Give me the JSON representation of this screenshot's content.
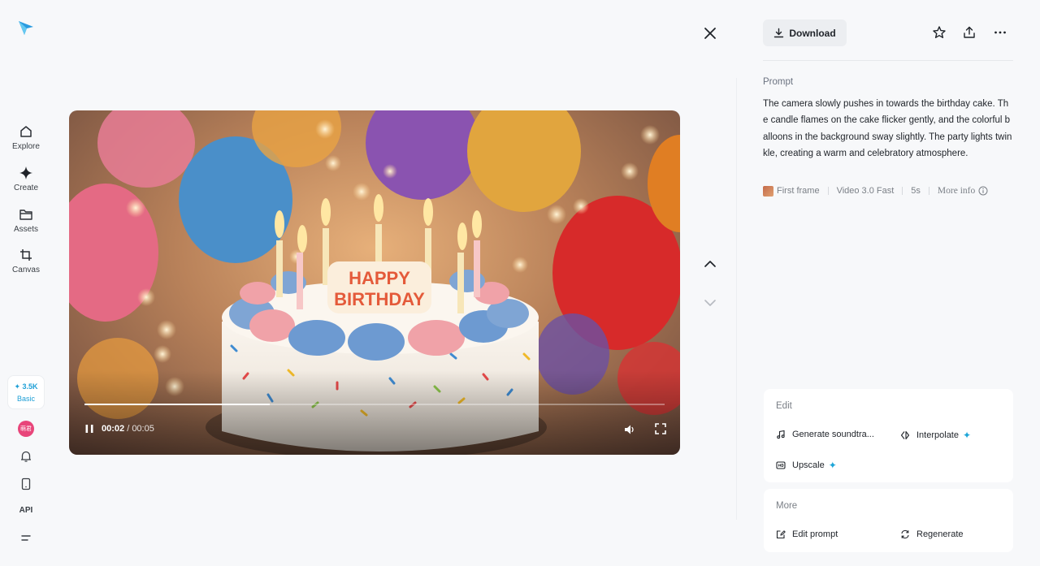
{
  "nav": {
    "items": [
      {
        "label": "Explore",
        "icon": "home-icon"
      },
      {
        "label": "Create",
        "icon": "sparkle-icon"
      },
      {
        "label": "Assets",
        "icon": "folder-icon"
      },
      {
        "label": "Canvas",
        "icon": "crop-icon"
      }
    ],
    "credits": {
      "amount": "✦ 3.5K",
      "plan": "Basic"
    },
    "avatar_text": "萌君",
    "api_label": "API"
  },
  "video": {
    "cake_text_line1": "HAPPY",
    "cake_text_line2": "BIRTHDAY",
    "current_time": "00:02",
    "duration": "/ 00:05",
    "progress": 0.32
  },
  "actions": {
    "download_label": "Download"
  },
  "prompt": {
    "label": "Prompt",
    "text": "The camera slowly pushes in towards the birthday cake. The candle flames on the cake flicker gently, and the colorful balloons in the background sway slightly. The party lights twinkle, creating a warm and celebratory atmosphere."
  },
  "meta": {
    "first_frame": "First frame",
    "model": "Video 3.0 Fast",
    "length": "5s",
    "more_info": "More info"
  },
  "edit": {
    "title": "Edit",
    "generate_soundtrack": "Generate soundtra...",
    "interpolate": "Interpolate",
    "upscale": "Upscale"
  },
  "more": {
    "title": "More",
    "edit_prompt": "Edit prompt",
    "regenerate": "Regenerate"
  },
  "colors": {
    "accent": "#1ea6d8",
    "background": "#f7f8fa"
  }
}
